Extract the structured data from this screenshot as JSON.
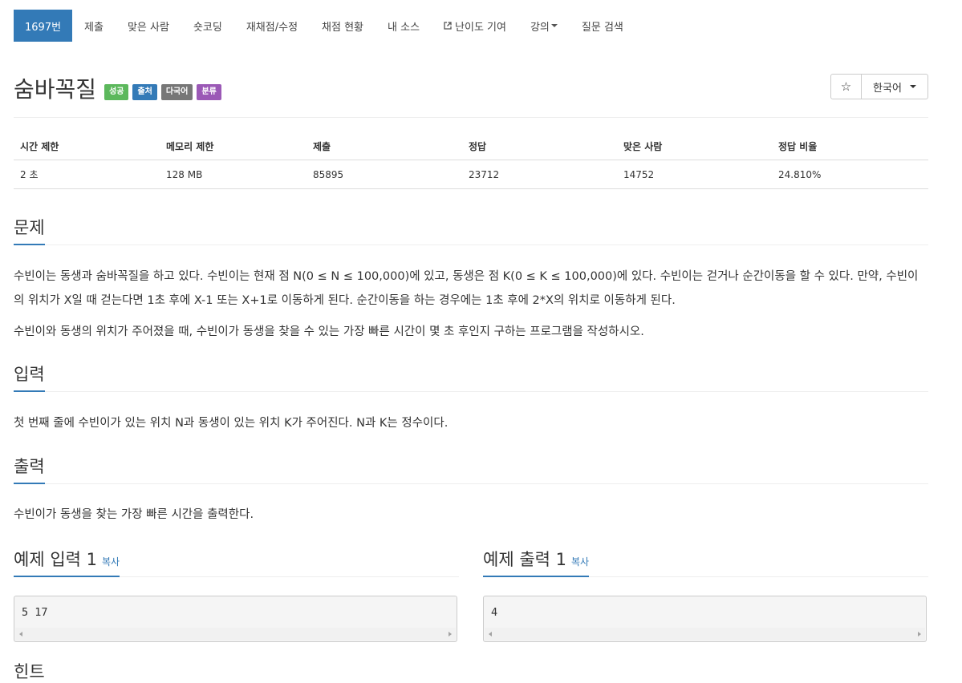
{
  "nav": {
    "items": [
      {
        "label": "1697번",
        "active": true
      },
      {
        "label": "제출"
      },
      {
        "label": "맞은 사람"
      },
      {
        "label": "숏코딩"
      },
      {
        "label": "재채점/수정"
      },
      {
        "label": "채점 현황"
      },
      {
        "label": "내 소스"
      },
      {
        "label": "난이도 기여",
        "icon": "external-link-icon"
      },
      {
        "label": "강의",
        "icon": "caret-down-icon"
      },
      {
        "label": "질문 검색"
      }
    ]
  },
  "problem": {
    "title": "숨바꼭질",
    "labels": [
      {
        "text": "성공",
        "color": "#5cb85c"
      },
      {
        "text": "출처",
        "color": "#337ab7"
      },
      {
        "text": "다국어",
        "color": "#777777"
      },
      {
        "text": "분류",
        "color": "#9b59b6"
      }
    ],
    "star_icon": "☆",
    "language": "한국어"
  },
  "info": {
    "headers": [
      "시간 제한",
      "메모리 제한",
      "제출",
      "정답",
      "맞은 사람",
      "정답 비율"
    ],
    "values": [
      "2 초",
      "128 MB",
      "85895",
      "23712",
      "14752",
      "24.810%"
    ]
  },
  "sections": {
    "description": {
      "heading": "문제",
      "paragraphs": [
        "수빈이는 동생과 숨바꼭질을 하고 있다. 수빈이는 현재 점 N(0 ≤ N ≤ 100,000)에 있고, 동생은 점 K(0 ≤ K ≤ 100,000)에 있다. 수빈이는 걷거나 순간이동을 할 수 있다. 만약, 수빈이의 위치가 X일 때 걷는다면 1초 후에 X-1 또는 X+1로 이동하게 된다. 순간이동을 하는 경우에는 1초 후에 2*X의 위치로 이동하게 된다.",
        "수빈이와 동생의 위치가 주어졌을 때, 수빈이가 동생을 찾을 수 있는 가장 빠른 시간이 몇 초 후인지 구하는 프로그램을 작성하시오."
      ]
    },
    "input": {
      "heading": "입력",
      "text": "첫 번째 줄에 수빈이가 있는 위치 N과 동생이 있는 위치 K가 주어진다. N과 K는 정수이다."
    },
    "output": {
      "heading": "출력",
      "text": "수빈이가 동생을 찾는 가장 빠른 시간을 출력한다."
    },
    "sample_input": {
      "heading": "예제 입력 1",
      "copy": "복사",
      "content": "5 17"
    },
    "sample_output": {
      "heading": "예제 출력 1",
      "copy": "복사",
      "content": "4"
    },
    "hint": {
      "heading": "힌트"
    }
  },
  "colors": {
    "accent": "#337ab7",
    "success": "#5cb85c",
    "default": "#777777",
    "purple": "#9b59b6"
  }
}
